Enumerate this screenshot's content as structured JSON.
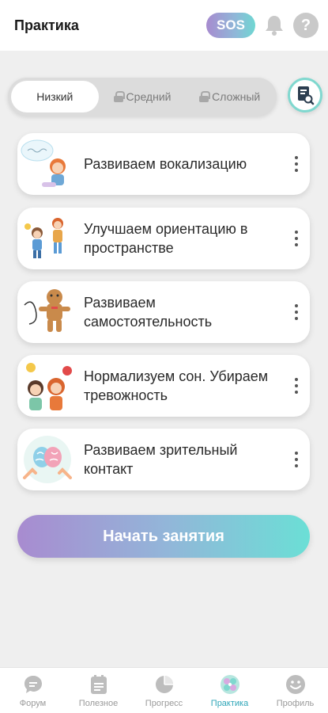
{
  "header": {
    "title": "Практика",
    "sos_label": "SOS",
    "help_label": "?"
  },
  "levels": [
    {
      "label": "Низкий",
      "locked": false,
      "active": true
    },
    {
      "label": "Средний",
      "locked": true,
      "active": false
    },
    {
      "label": "Сложный",
      "locked": true,
      "active": false
    }
  ],
  "cards": [
    {
      "label": "Развиваем вокализацию",
      "thumb": "girl-singing-illustration"
    },
    {
      "label": "Улучшаем ориентацию в пространстве",
      "thumb": "kids-playing-illustration"
    },
    {
      "label": "Развиваем самостоятельность",
      "thumb": "gingerbread-illustration"
    },
    {
      "label": "Нормализуем сон. Убираем тревожность",
      "thumb": "calm-kids-illustration"
    },
    {
      "label": "Развиваем зрительный контакт",
      "thumb": "brain-hands-illustration"
    }
  ],
  "start_button": {
    "label": "Начать занятия"
  },
  "tabbar": [
    {
      "label": "Форум",
      "icon": "forum-icon",
      "active": false
    },
    {
      "label": "Полезное",
      "icon": "useful-icon",
      "active": false
    },
    {
      "label": "Прогресс",
      "icon": "progress-icon",
      "active": false
    },
    {
      "label": "Практика",
      "icon": "practice-icon",
      "active": true
    },
    {
      "label": "Профиль",
      "icon": "profile-icon",
      "active": false
    }
  ],
  "colors": {
    "accent": "#2fa6b8",
    "gradient_start": "#a88bd0",
    "gradient_end": "#6bdfd6"
  }
}
